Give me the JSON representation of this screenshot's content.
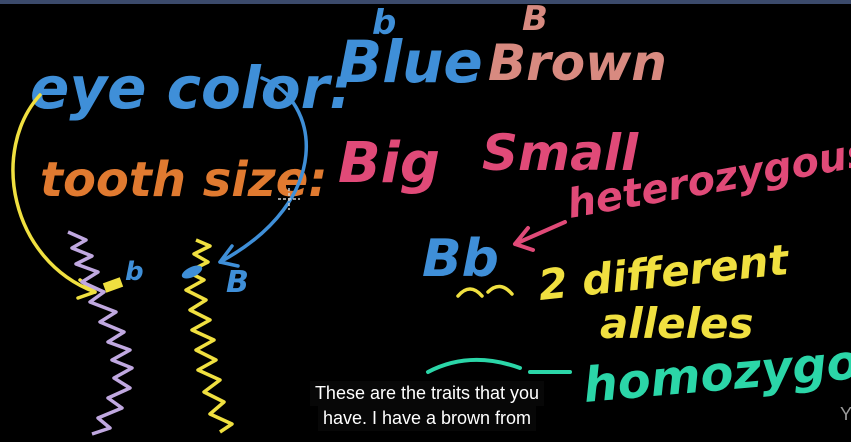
{
  "board": {
    "eye_label": "eye color:",
    "eye_recessive": "Blue",
    "eye_dominant": "Brown",
    "eye_recessive_letter": "b",
    "eye_dominant_letter": "B",
    "tooth_label": "tooth size:",
    "tooth_trait_1": "Big",
    "tooth_trait_2": "Small",
    "heterozygous": "heterozygous",
    "genotype": "Bb",
    "different_alleles_line1": "2 different",
    "different_alleles_line2": "alleles",
    "homozygous": "homozygous",
    "chromosome_left_allele": "b",
    "chromosome_right_allele": "B"
  },
  "caption": {
    "line1": "These are the traits that you",
    "line2": "have. I have a brown from"
  },
  "watermark": "Y",
  "colors": {
    "blue": "#3f8fd8",
    "pink": "#e04a78",
    "salmon": "#d88a80",
    "orange": "#e07a30",
    "yellow": "#f0e040",
    "purple": "#c0a8e0",
    "teal": "#2bd6a8"
  }
}
